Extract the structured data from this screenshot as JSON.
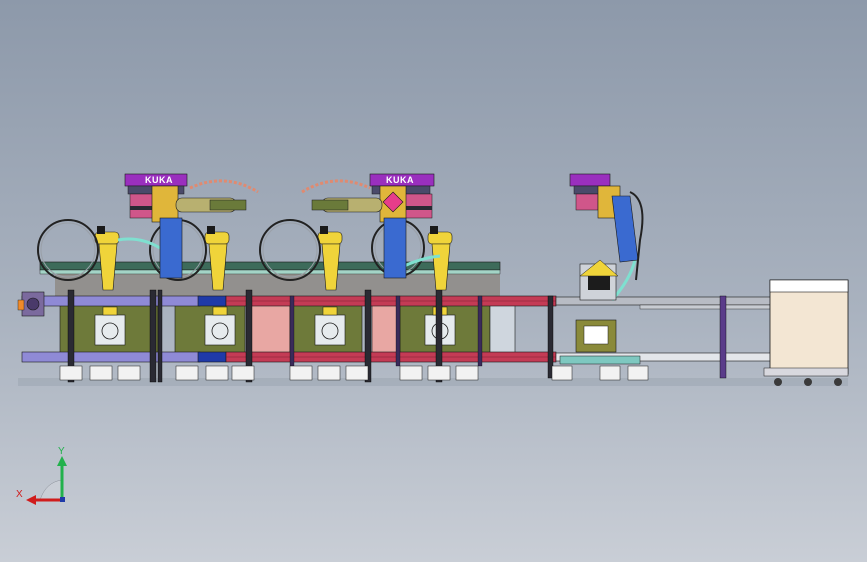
{
  "robot_brand_left": "KUKA",
  "robot_brand_right": "KUKA",
  "triad": {
    "x_label": "X",
    "y_label": "Y"
  },
  "colors": {
    "background_top": "#8d99aa",
    "rail_red": "#c43b55",
    "rail_lavender": "#8f8ad6",
    "robot_yellow": "#f0d43a",
    "robot_purple": "#9a2fbe",
    "base_olive": "#6e7a3a",
    "pink_panel": "#e8a7a3",
    "cabinet_beige": "#f3e6d3"
  }
}
